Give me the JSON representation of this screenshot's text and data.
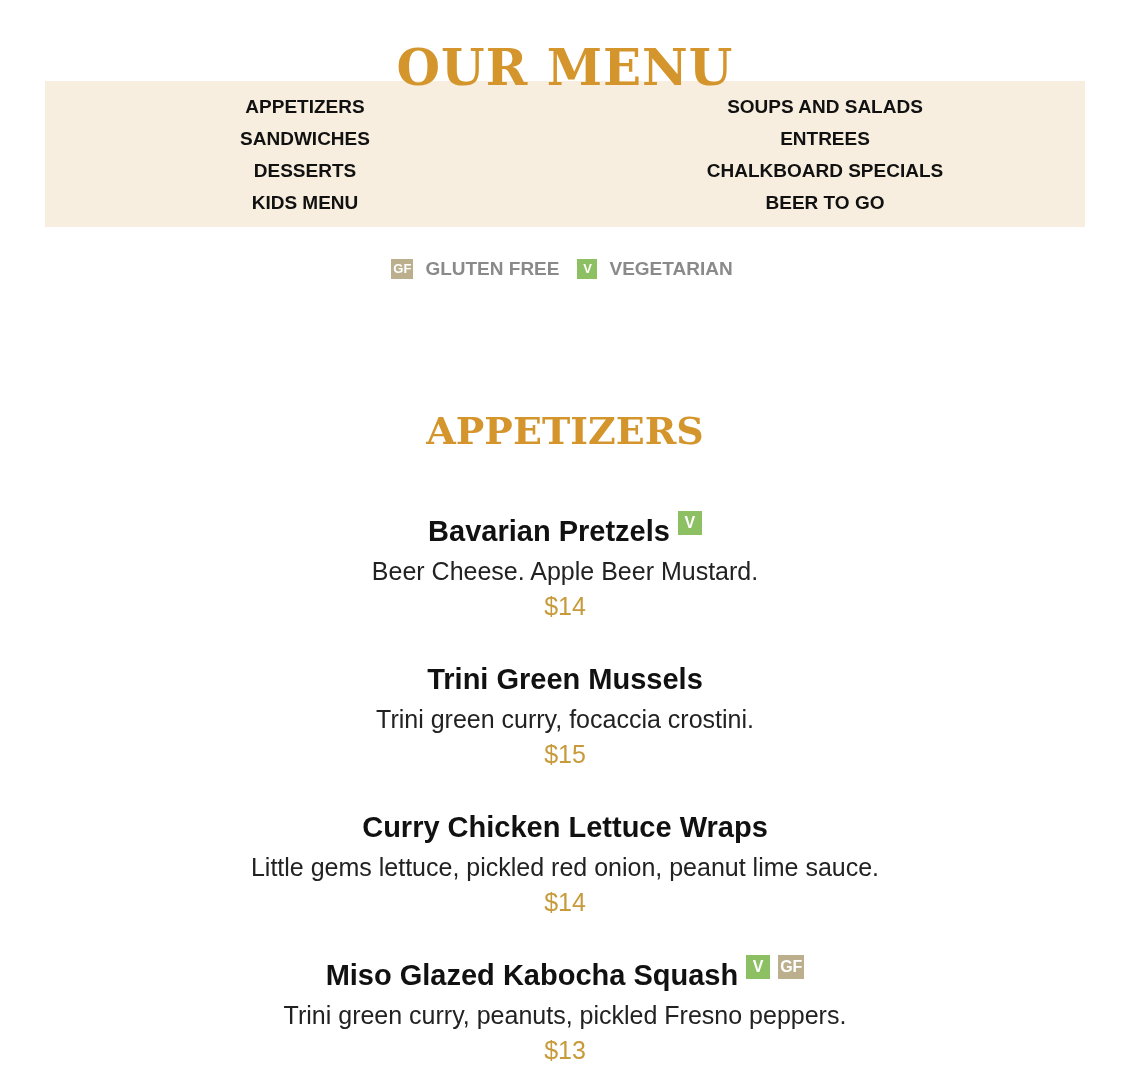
{
  "title": "OUR MENU",
  "nav": [
    {
      "label": "APPETIZERS"
    },
    {
      "label": "SOUPS AND SALADS"
    },
    {
      "label": "SANDWICHES"
    },
    {
      "label": "ENTREES"
    },
    {
      "label": "DESSERTS"
    },
    {
      "label": "CHALKBOARD SPECIALS"
    },
    {
      "label": "KIDS MENU"
    },
    {
      "label": "BEER TO GO"
    }
  ],
  "legend": [
    {
      "kind": "gf",
      "badge": "GF",
      "label": "GLUTEN FREE"
    },
    {
      "kind": "v",
      "badge": "V",
      "label": "VEGETARIAN"
    }
  ],
  "section": {
    "title": "APPETIZERS",
    "items": [
      {
        "name": "Bavarian Pretzels",
        "tags": [
          {
            "kind": "v",
            "label": "V"
          }
        ],
        "description": "Beer Cheese. Apple Beer Mustard.",
        "price": "$14"
      },
      {
        "name": "Trini Green Mussels",
        "description": "Trini green curry, focaccia crostini.",
        "price": "$15"
      },
      {
        "name": "Curry Chicken Lettuce Wraps",
        "description": "Little gems lettuce, pickled red onion, peanut lime sauce.",
        "price": "$14"
      },
      {
        "name": "Miso Glazed Kabocha Squash",
        "tags": [
          {
            "kind": "v",
            "label": "V"
          },
          {
            "kind": "gf",
            "label": "GF"
          }
        ],
        "description": "Trini green curry, peanuts, pickled Fresno peppers.",
        "price": "$13"
      }
    ]
  }
}
